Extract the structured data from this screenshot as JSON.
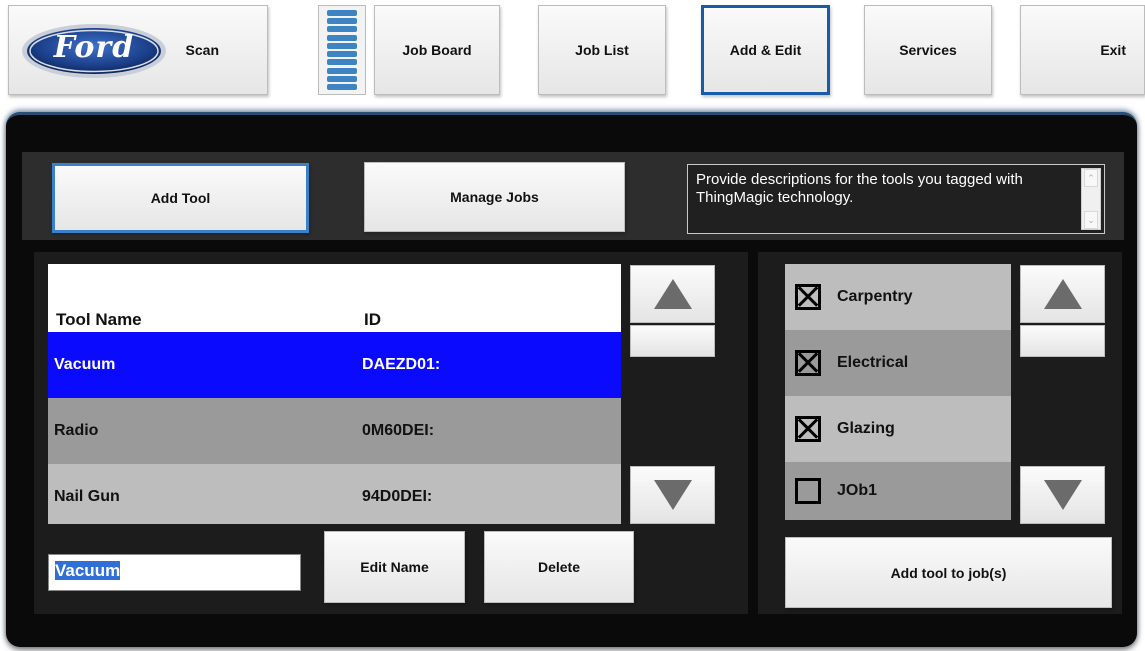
{
  "top_nav": {
    "logo_text": "Ford",
    "scan_label": "Scan",
    "job_board_label": "Job Board",
    "job_list_label": "Job List",
    "add_edit_label": "Add & Edit",
    "services_label": "Services",
    "exit_label": "Exit",
    "active": "Add & Edit"
  },
  "sub_tabs": {
    "add_tool_label": "Add Tool",
    "manage_jobs_label": "Manage Jobs",
    "active": "Add Tool"
  },
  "description": "Provide descriptions for the tools you tagged with ThingMagic technology.",
  "tools_table": {
    "columns": [
      "Tool Name",
      "ID"
    ],
    "rows": [
      {
        "name": "Vacuum",
        "id": "DAEZD01:"
      },
      {
        "name": "Radio",
        "id": "0M60DEI:"
      },
      {
        "name": "Nail Gun",
        "id": "94D0DEI:"
      }
    ],
    "selected_row": 0
  },
  "editor": {
    "name_value": "Vacuum",
    "edit_name_label": "Edit Name",
    "delete_label": "Delete"
  },
  "jobs": {
    "items": [
      {
        "label": "Carpentry",
        "checked": true
      },
      {
        "label": "Electrical",
        "checked": true
      },
      {
        "label": "Glazing",
        "checked": true
      },
      {
        "label": "JOb1",
        "checked": false
      }
    ],
    "add_to_jobs_label": "Add tool to job(s)"
  },
  "colors": {
    "selection": "#0a0aff",
    "active_border": "#1a5aa6",
    "frame_accent": "#2a4e74"
  }
}
